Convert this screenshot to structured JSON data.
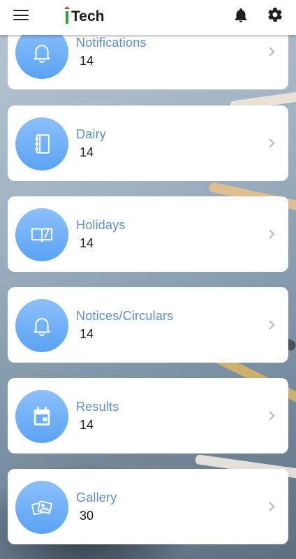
{
  "app": {
    "brand": "Tech",
    "brand_mark_colors": [
      "#e53935",
      "#2e9e3e"
    ]
  },
  "header": {
    "menu_icon": "menu-icon",
    "notifications_icon": "bell-icon",
    "settings_icon": "gear-icon"
  },
  "accent": "#5e8fc1",
  "items": [
    {
      "title": "Notifications",
      "count": "14",
      "icon": "bell-icon"
    },
    {
      "title": "Dairy",
      "count": "14",
      "icon": "diary-icon"
    },
    {
      "title": "Holidays",
      "count": "14",
      "icon": "open-book-icon"
    },
    {
      "title": "Notices/Circulars",
      "count": "14",
      "icon": "bell-icon"
    },
    {
      "title": "Results",
      "count": "14",
      "icon": "calendar-icon"
    },
    {
      "title": "Gallery",
      "count": "30",
      "icon": "gallery-icon"
    }
  ]
}
